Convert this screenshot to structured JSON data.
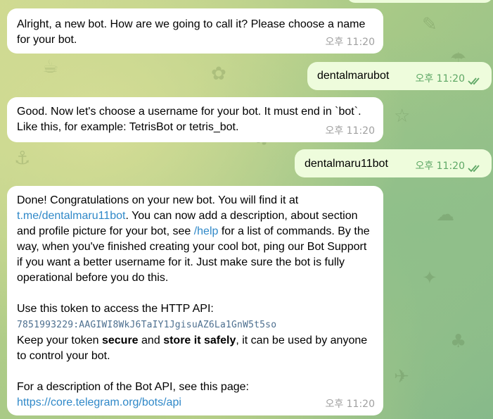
{
  "messages": [
    {
      "id": "m1",
      "direction": "incoming",
      "text": "Alright, a new bot. How are we going to call it? Please choose a name for your bot.",
      "time": "오후 11:20"
    },
    {
      "id": "m2",
      "direction": "outgoing",
      "text": "dentalmarubot",
      "time": "오후 11:20",
      "status": "read"
    },
    {
      "id": "m3",
      "direction": "incoming",
      "text": "Good. Now let's choose a username for your bot. It must end in `bot`. Like this, for example: TetrisBot or tetris_bot.",
      "time": "오후 11:20"
    },
    {
      "id": "m4",
      "direction": "outgoing",
      "text": "dentalmaru11bot",
      "time": "오후 11:20",
      "status": "read"
    },
    {
      "id": "m5",
      "direction": "incoming",
      "time": "오후 11:20",
      "p1_a": "Done! Congratulations on your new bot. You will find it at",
      "p1_link": "t.me/dentalmaru11bot",
      "p1_b": ". You can now add a description, about section and profile picture for your bot, see",
      "p1_help": "/help",
      "p1_c": "for a list of commands. By the way, when you've finished creating your cool bot, ping our Bot Support if you want a better username for it. Just make sure the bot is fully operational before you do this.",
      "p2_a": "Use this token to access the HTTP API:",
      "token": "7851993229:AAGIWI8WkJ6TaIY1JgisuAZ6La1GnW5t5so",
      "p2_b": "Keep your token",
      "p2_secure": "secure",
      "p2_and": "and",
      "p2_store": "store it safely",
      "p2_c": ", it can be used by anyone to control your bot.",
      "p3_a": "For a description of the Bot API, see this page:",
      "p3_link": "https://core.telegram.org/bots/api"
    }
  ],
  "colors": {
    "incoming_bubble": "#ffffff",
    "outgoing_bubble": "#eefcdc",
    "link": "#2f88c8",
    "read_check": "#5fa866"
  }
}
